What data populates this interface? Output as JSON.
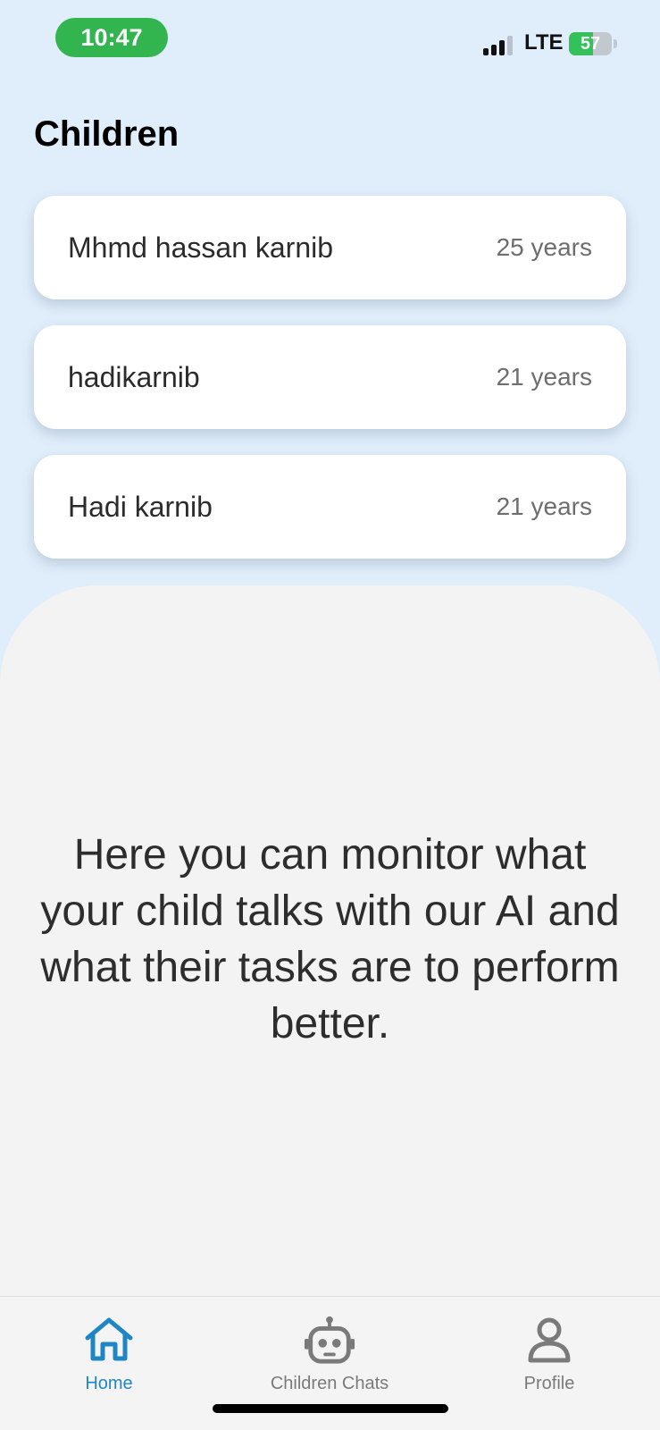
{
  "status_bar": {
    "time": "10:47",
    "network": "LTE",
    "battery_percent": 57,
    "battery_label": "57"
  },
  "page": {
    "title": "Children"
  },
  "children": [
    {
      "name": "Mhmd hassan karnib",
      "age": "25 years"
    },
    {
      "name": "hadikarnib",
      "age": "21 years"
    },
    {
      "name": "Hadi karnib",
      "age": "21 years"
    }
  ],
  "info": {
    "text": "Here you can monitor what your child talks with our AI and what their tasks are to perform better."
  },
  "tabs": [
    {
      "label": "Home",
      "icon": "home-icon",
      "active": true
    },
    {
      "label": "Children Chats",
      "icon": "robot-icon",
      "active": false
    },
    {
      "label": "Profile",
      "icon": "user-icon",
      "active": false
    }
  ],
  "colors": {
    "background": "#e0eefb",
    "accent": "#1f86c6",
    "time_pill": "#32b44e",
    "panel": "#f3f3f3"
  }
}
